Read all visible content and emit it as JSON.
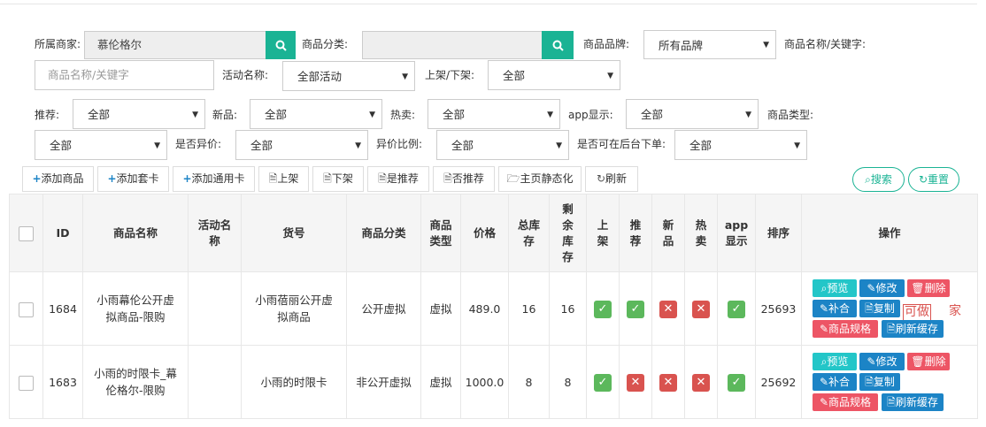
{
  "filters": {
    "merchant_label": "所属商家:",
    "merchant_value": "慕伦格尔",
    "category_label": "商品分类:",
    "category_value": "",
    "brand_label": "商品品牌:",
    "brand_value": "所有品牌",
    "keyword_label": "商品名称/关键字:",
    "keyword_placeholder": "商品名称/关键字",
    "activity_label": "活动名称:",
    "activity_value": "全部活动",
    "shelf_label": "上架/下架:",
    "shelf_value": "全部",
    "recommend_label": "推荐:",
    "recommend_value": "全部",
    "new_label": "新品:",
    "new_value": "全部",
    "hot_label": "热卖:",
    "hot_value": "全部",
    "app_label": "app显示:",
    "app_value": "全部",
    "type_label": "商品类型:",
    "type_value": "全部",
    "diff_label": "是否异价:",
    "diff_value": "全部",
    "ratio_label": "异价比例:",
    "ratio_value": "全部",
    "backend_label": "是否可在后台下单:",
    "backend_value": "全部"
  },
  "toolbar": {
    "add_goods": "添加商品",
    "add_card": "添加套卡",
    "add_general": "添加通用卡",
    "on_shelf": "上架",
    "off_shelf": "下架",
    "set_recommend": "是推荐",
    "unset_recommend": "否推荐",
    "static_home": "主页静态化",
    "refresh": "刷新",
    "search": "搜索",
    "reset": "重置"
  },
  "table": {
    "headers": {
      "id": "ID",
      "name": "商品名称",
      "activity": "活动名称",
      "sku": "货号",
      "category": "商品分类",
      "type": "商品类型",
      "price": "价格",
      "stock": "总库存",
      "remain": "剩余库存",
      "on_shelf": "上架",
      "recommend": "推荐",
      "new": "新品",
      "hot": "热卖",
      "app": "app显示",
      "sort": "排序",
      "ops": "操作"
    },
    "rows": [
      {
        "id": "1684",
        "name": "小雨幕伦公开虚拟商品-限购",
        "activity": "",
        "sku": "小雨蓓丽公开虚拟商品",
        "category": "公开虚拟",
        "type": "虚拟",
        "price": "489.0",
        "stock": "16",
        "remain": "16",
        "on_shelf": true,
        "recommend": true,
        "new": false,
        "hot": false,
        "app": true,
        "sort": "25693"
      },
      {
        "id": "1683",
        "name": "小雨的时限卡_幕伦格尔-限购",
        "activity": "",
        "sku": "小雨的时限卡",
        "category": "非公开虚拟",
        "type": "虚拟",
        "price": "1000.0",
        "stock": "8",
        "remain": "8",
        "on_shelf": true,
        "recommend": false,
        "new": false,
        "hot": false,
        "app": true,
        "sort": "25692"
      }
    ],
    "ops": {
      "preview": "预览",
      "edit": "修改",
      "delete": "删除",
      "supplement": "补合",
      "copy": "复制",
      "spec": "商品规格",
      "refresh_cache": "刷新缓存"
    },
    "overlay_text": "可做",
    "overlay_text2": "家"
  }
}
